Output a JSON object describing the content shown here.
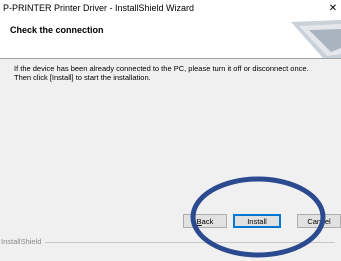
{
  "window": {
    "title": "P-PRINTER Printer Driver - InstallShield Wizard",
    "close_label": "✕"
  },
  "header": {
    "title": "Check the connection"
  },
  "body": {
    "message_line1": "If the device has been already connected to the PC, please turn it off or disconnect once.",
    "message_line2": "Then click [Install] to start the installation."
  },
  "footer": {
    "brand": "InstallShield"
  },
  "buttons": {
    "back_prefix": "B",
    "back_rest": "ack",
    "install_label": "Install",
    "cancel_label": "Cancel"
  },
  "colors": {
    "highlight_ring": "#2c4a8f",
    "focus_border": "#0078d7"
  }
}
